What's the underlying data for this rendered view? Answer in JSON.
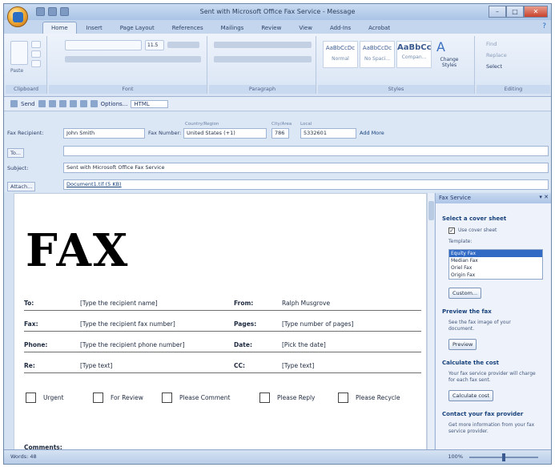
{
  "window": {
    "title": "Sent with Microsoft Office Fax Service - Message"
  },
  "ribbon_tabs": [
    "Home",
    "Insert",
    "Page Layout",
    "References",
    "Mailings",
    "Review",
    "View",
    "Add-Ins",
    "Acrobat"
  ],
  "ribbon": {
    "groups": [
      "Clipboard",
      "Font",
      "Paragraph",
      "Styles",
      "Editing"
    ],
    "clipboard_paste": "Paste",
    "font_size": "11.5",
    "styles": [
      {
        "sample": "AaBbCcDc",
        "name": "Normal"
      },
      {
        "sample": "AaBbCcDc",
        "name": "No Spaci..."
      },
      {
        "sample": "AaBbCc",
        "name": "Compan..."
      }
    ],
    "change_styles": "Change Styles",
    "editing": [
      "Find",
      "Replace",
      "Select"
    ]
  },
  "toolbar": {
    "send": "Send",
    "options": "Options...",
    "format": "HTML"
  },
  "header": {
    "fax_recipient_label": "Fax Recipient:",
    "fax_recipient_value": "John Smith",
    "fax_number_label": "Fax Number:",
    "country_label": "Country/Region",
    "country_value": "United States (+1)",
    "city_label": "City/Area",
    "city_value": "786",
    "local_label": "Local",
    "local_value": "5332601",
    "add_more": "Add More",
    "to_label": "To...",
    "to_value": "",
    "subject_label": "Subject:",
    "subject_value": "Sent with Microsoft Office Fax Service",
    "attach_label": "Attach...",
    "attach_value": "Document1.tif (5 KB)"
  },
  "document": {
    "title": "FAX",
    "rows": [
      {
        "l1": "To:",
        "v1": "[Type the recipient name]",
        "l2": "From:",
        "v2": "Ralph Musgrove"
      },
      {
        "l1": "Fax:",
        "v1": "[Type the recipient fax number]",
        "l2": "Pages:",
        "v2": "[Type number of pages]"
      },
      {
        "l1": "Phone:",
        "v1": "[Type the recipient phone number]",
        "l2": "Date:",
        "v2": "[Pick the date]"
      },
      {
        "l1": "Re:",
        "v1": "[Type text]",
        "l2": "CC:",
        "v2": "[Type text]"
      }
    ],
    "checkboxes": [
      "Urgent",
      "For Review",
      "Please Comment",
      "Please Reply",
      "Please Recycle"
    ],
    "comments_label": "Comments:"
  },
  "pane": {
    "title": "Fax Service",
    "sec1": "Select a cover sheet",
    "use_cover": "Use cover sheet",
    "template_label": "Template:",
    "templates": [
      "Equity Fax",
      "Median Fax",
      "Oriel Fax",
      "Origin Fax"
    ],
    "custom_btn": "Custom...",
    "sec2": "Preview the fax",
    "sec2_text": "See the fax image of your document.",
    "preview_btn": "Preview",
    "sec3": "Calculate the cost",
    "sec3_text": "Your fax service provider will charge for each fax sent.",
    "calc_btn": "Calculate cost",
    "sec4": "Contact your fax provider",
    "sec4_text": "Get more information from your fax service provider."
  },
  "status": {
    "words": "Words: 48",
    "zoom": "100%"
  }
}
